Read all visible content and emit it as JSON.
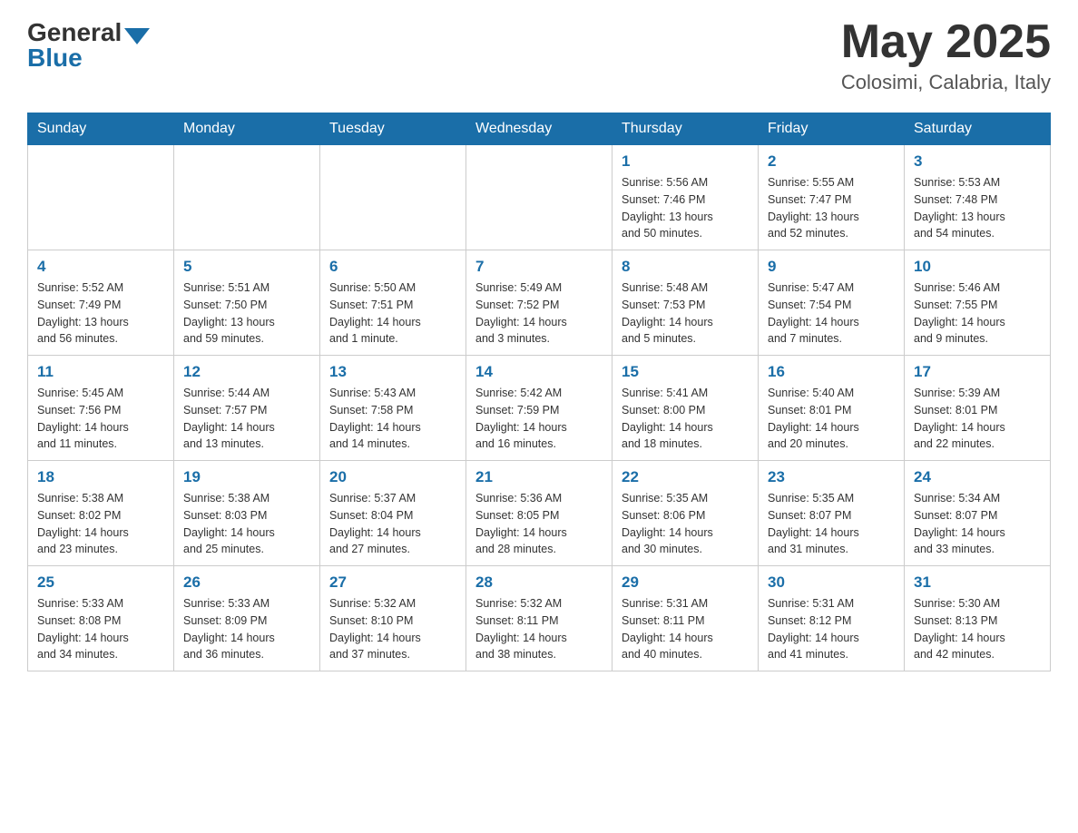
{
  "header": {
    "logo_general": "General",
    "logo_blue": "Blue",
    "month_title": "May 2025",
    "location": "Colosimi, Calabria, Italy"
  },
  "weekdays": [
    "Sunday",
    "Monday",
    "Tuesday",
    "Wednesday",
    "Thursday",
    "Friday",
    "Saturday"
  ],
  "weeks": [
    [
      {
        "day": "",
        "info": ""
      },
      {
        "day": "",
        "info": ""
      },
      {
        "day": "",
        "info": ""
      },
      {
        "day": "",
        "info": ""
      },
      {
        "day": "1",
        "info": "Sunrise: 5:56 AM\nSunset: 7:46 PM\nDaylight: 13 hours\nand 50 minutes."
      },
      {
        "day": "2",
        "info": "Sunrise: 5:55 AM\nSunset: 7:47 PM\nDaylight: 13 hours\nand 52 minutes."
      },
      {
        "day": "3",
        "info": "Sunrise: 5:53 AM\nSunset: 7:48 PM\nDaylight: 13 hours\nand 54 minutes."
      }
    ],
    [
      {
        "day": "4",
        "info": "Sunrise: 5:52 AM\nSunset: 7:49 PM\nDaylight: 13 hours\nand 56 minutes."
      },
      {
        "day": "5",
        "info": "Sunrise: 5:51 AM\nSunset: 7:50 PM\nDaylight: 13 hours\nand 59 minutes."
      },
      {
        "day": "6",
        "info": "Sunrise: 5:50 AM\nSunset: 7:51 PM\nDaylight: 14 hours\nand 1 minute."
      },
      {
        "day": "7",
        "info": "Sunrise: 5:49 AM\nSunset: 7:52 PM\nDaylight: 14 hours\nand 3 minutes."
      },
      {
        "day": "8",
        "info": "Sunrise: 5:48 AM\nSunset: 7:53 PM\nDaylight: 14 hours\nand 5 minutes."
      },
      {
        "day": "9",
        "info": "Sunrise: 5:47 AM\nSunset: 7:54 PM\nDaylight: 14 hours\nand 7 minutes."
      },
      {
        "day": "10",
        "info": "Sunrise: 5:46 AM\nSunset: 7:55 PM\nDaylight: 14 hours\nand 9 minutes."
      }
    ],
    [
      {
        "day": "11",
        "info": "Sunrise: 5:45 AM\nSunset: 7:56 PM\nDaylight: 14 hours\nand 11 minutes."
      },
      {
        "day": "12",
        "info": "Sunrise: 5:44 AM\nSunset: 7:57 PM\nDaylight: 14 hours\nand 13 minutes."
      },
      {
        "day": "13",
        "info": "Sunrise: 5:43 AM\nSunset: 7:58 PM\nDaylight: 14 hours\nand 14 minutes."
      },
      {
        "day": "14",
        "info": "Sunrise: 5:42 AM\nSunset: 7:59 PM\nDaylight: 14 hours\nand 16 minutes."
      },
      {
        "day": "15",
        "info": "Sunrise: 5:41 AM\nSunset: 8:00 PM\nDaylight: 14 hours\nand 18 minutes."
      },
      {
        "day": "16",
        "info": "Sunrise: 5:40 AM\nSunset: 8:01 PM\nDaylight: 14 hours\nand 20 minutes."
      },
      {
        "day": "17",
        "info": "Sunrise: 5:39 AM\nSunset: 8:01 PM\nDaylight: 14 hours\nand 22 minutes."
      }
    ],
    [
      {
        "day": "18",
        "info": "Sunrise: 5:38 AM\nSunset: 8:02 PM\nDaylight: 14 hours\nand 23 minutes."
      },
      {
        "day": "19",
        "info": "Sunrise: 5:38 AM\nSunset: 8:03 PM\nDaylight: 14 hours\nand 25 minutes."
      },
      {
        "day": "20",
        "info": "Sunrise: 5:37 AM\nSunset: 8:04 PM\nDaylight: 14 hours\nand 27 minutes."
      },
      {
        "day": "21",
        "info": "Sunrise: 5:36 AM\nSunset: 8:05 PM\nDaylight: 14 hours\nand 28 minutes."
      },
      {
        "day": "22",
        "info": "Sunrise: 5:35 AM\nSunset: 8:06 PM\nDaylight: 14 hours\nand 30 minutes."
      },
      {
        "day": "23",
        "info": "Sunrise: 5:35 AM\nSunset: 8:07 PM\nDaylight: 14 hours\nand 31 minutes."
      },
      {
        "day": "24",
        "info": "Sunrise: 5:34 AM\nSunset: 8:07 PM\nDaylight: 14 hours\nand 33 minutes."
      }
    ],
    [
      {
        "day": "25",
        "info": "Sunrise: 5:33 AM\nSunset: 8:08 PM\nDaylight: 14 hours\nand 34 minutes."
      },
      {
        "day": "26",
        "info": "Sunrise: 5:33 AM\nSunset: 8:09 PM\nDaylight: 14 hours\nand 36 minutes."
      },
      {
        "day": "27",
        "info": "Sunrise: 5:32 AM\nSunset: 8:10 PM\nDaylight: 14 hours\nand 37 minutes."
      },
      {
        "day": "28",
        "info": "Sunrise: 5:32 AM\nSunset: 8:11 PM\nDaylight: 14 hours\nand 38 minutes."
      },
      {
        "day": "29",
        "info": "Sunrise: 5:31 AM\nSunset: 8:11 PM\nDaylight: 14 hours\nand 40 minutes."
      },
      {
        "day": "30",
        "info": "Sunrise: 5:31 AM\nSunset: 8:12 PM\nDaylight: 14 hours\nand 41 minutes."
      },
      {
        "day": "31",
        "info": "Sunrise: 5:30 AM\nSunset: 8:13 PM\nDaylight: 14 hours\nand 42 minutes."
      }
    ]
  ]
}
